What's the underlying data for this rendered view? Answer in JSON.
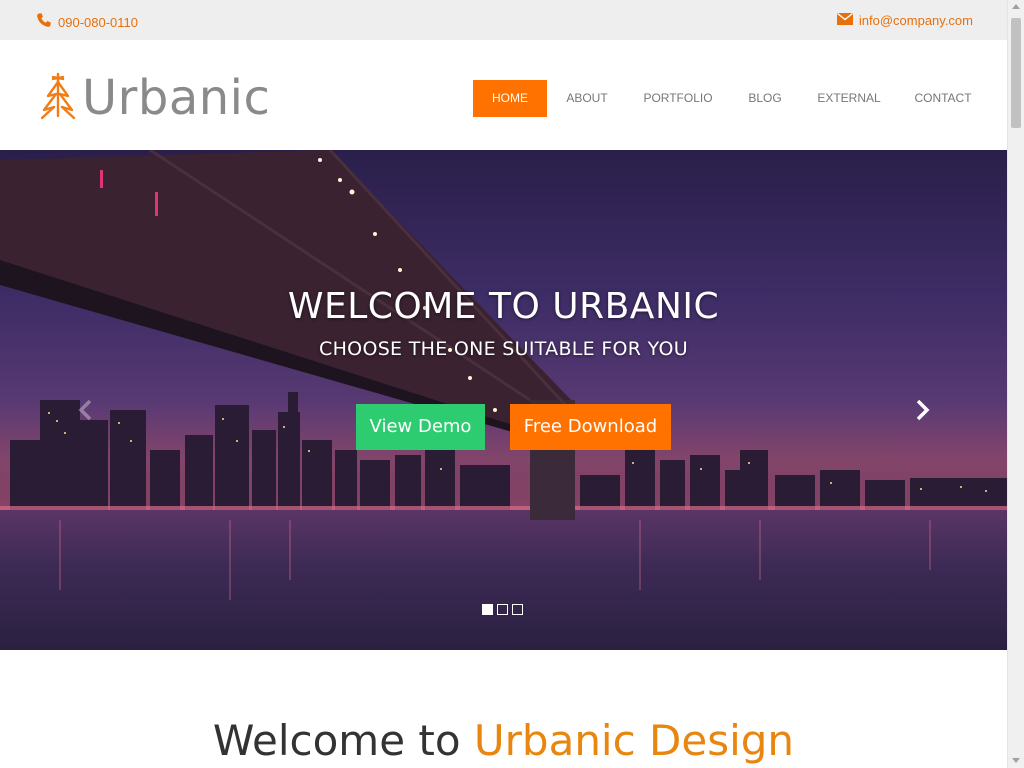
{
  "topbar": {
    "phone": "090-080-0110",
    "email": "info@company.com",
    "phone_icon": "phone-icon",
    "email_icon": "envelope-icon",
    "accent_color": "#e8700c"
  },
  "header": {
    "logo_text": "Urbanic",
    "logo_icon": "tree-icon",
    "nav": [
      {
        "label": "HOME",
        "active": true
      },
      {
        "label": "ABOUT"
      },
      {
        "label": "PORTFOLIO"
      },
      {
        "label": "BLOG"
      },
      {
        "label": "EXTERNAL"
      },
      {
        "label": "CONTACT"
      }
    ],
    "active_color": "#ff7200"
  },
  "hero": {
    "title": "WELCOME TO URBANIC",
    "subtitle": "CHOOSE THE ONE SUITABLE FOR YOU",
    "demo_button": "View Demo",
    "download_button": "Free Download",
    "demo_color": "#2ecc71",
    "download_color": "#ff7200",
    "prev_icon": "chevron-left-icon",
    "next_icon": "chevron-right-icon",
    "slides": 3,
    "active_slide": 1
  },
  "section": {
    "heading_plain": "Welcome to ",
    "heading_accent": "Urbanic Design",
    "accent_color": "#e8860f"
  }
}
